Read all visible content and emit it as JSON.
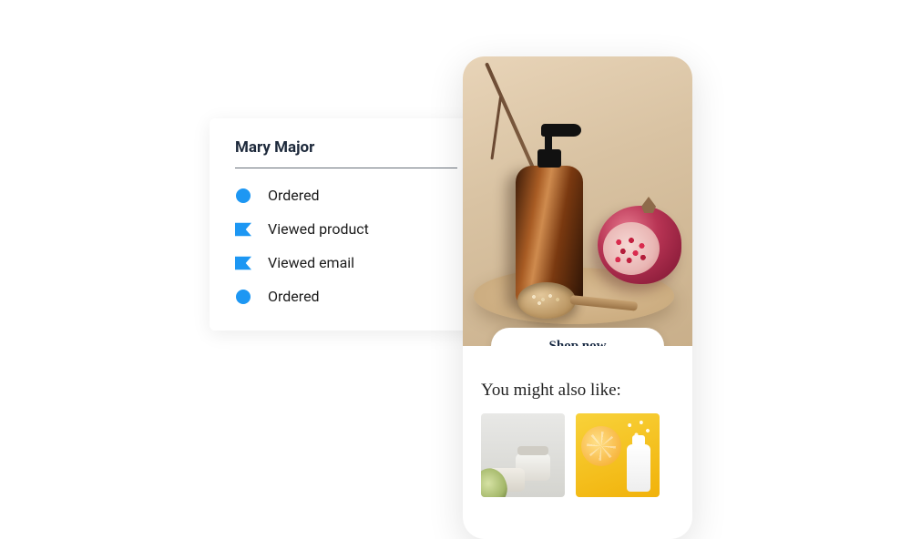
{
  "customer": {
    "name": "Mary Major",
    "activities": [
      {
        "icon": "circle-icon",
        "label": "Ordered"
      },
      {
        "icon": "flag-icon",
        "label": "Viewed product"
      },
      {
        "icon": "flag-icon",
        "label": "Viewed email"
      },
      {
        "icon": "circle-icon",
        "label": "Ordered"
      }
    ]
  },
  "email": {
    "cta_label": "Shop now",
    "recs_title": "You might also like:"
  },
  "colors": {
    "accent": "#1d97f3"
  }
}
